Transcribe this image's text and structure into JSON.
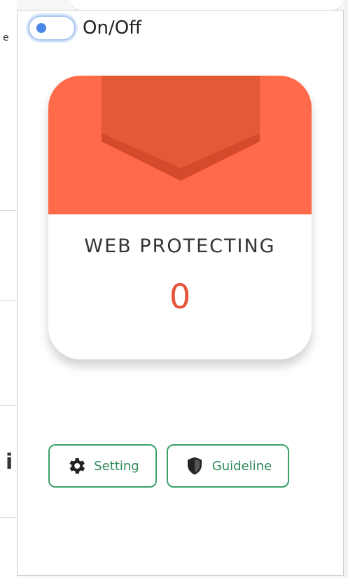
{
  "toggle": {
    "label": "On/Off",
    "checked": true
  },
  "card": {
    "title": "WEB PROTECTING",
    "count": "0",
    "icon": "shield-icon"
  },
  "buttons": {
    "setting": {
      "label": "Setting",
      "icon": "gear-icon"
    },
    "guideline": {
      "label": "Guideline",
      "icon": "shield-icon"
    }
  },
  "colors": {
    "header": "#ff6b4a",
    "shield": "#e55a36",
    "count": "#e4553c",
    "button_border": "#3aa06a",
    "toggle_knob": "#4b88e6"
  }
}
